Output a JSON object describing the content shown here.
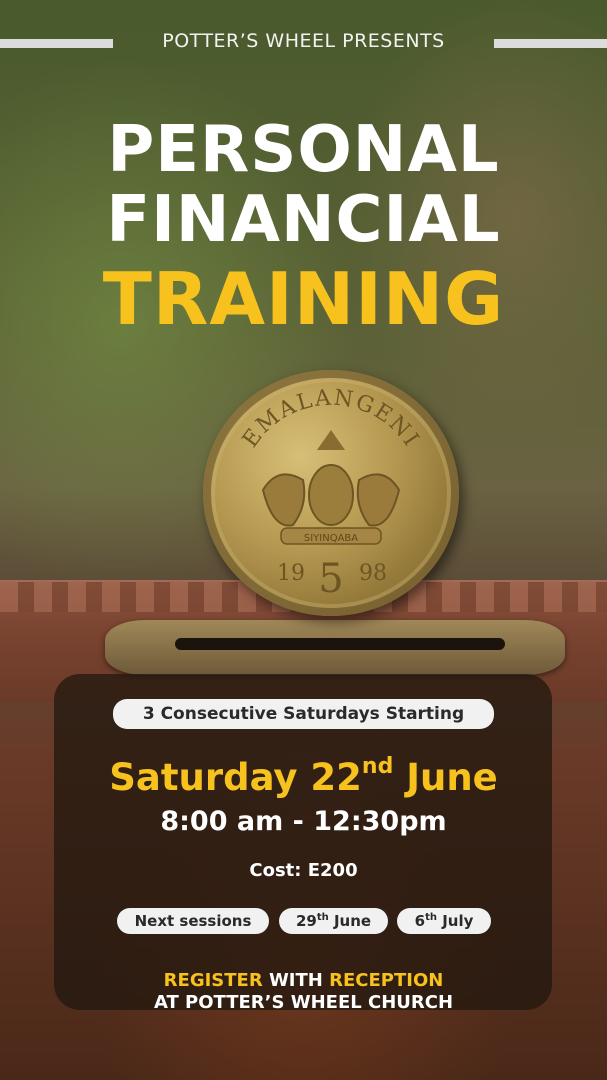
{
  "header": {
    "presents": "POTTER’S WHEEL PRESENTS"
  },
  "title": {
    "line1": "PERSONAL",
    "line2": "FINANCIAL",
    "line3": "TRAINING"
  },
  "coin": {
    "inscription_top": "EMALANGENI",
    "motto": "SIYINQABA",
    "year_left": "19",
    "denomination": "5",
    "year_right": "98"
  },
  "details": {
    "series_label": "3 Consecutive Saturdays Starting",
    "date_prefix": "Saturday 22",
    "date_suffix": "nd",
    "date_month": " June",
    "time": "8:00 am - 12:30pm",
    "cost": "Cost: E200",
    "next_label": "Next sessions",
    "session2_day": "29",
    "session2_suffix": "th",
    "session2_month": " June",
    "session3_day": "6",
    "session3_suffix": "th",
    "session3_month": " July"
  },
  "register": {
    "word1": "REGISTER",
    "word2": " WITH ",
    "word3": "RECEPTION",
    "line2": "AT POTTER’S WHEEL CHURCH"
  },
  "colors": {
    "accent": "#f7c21e",
    "text": "#ffffff",
    "pill_bg": "#f1f1f1"
  }
}
